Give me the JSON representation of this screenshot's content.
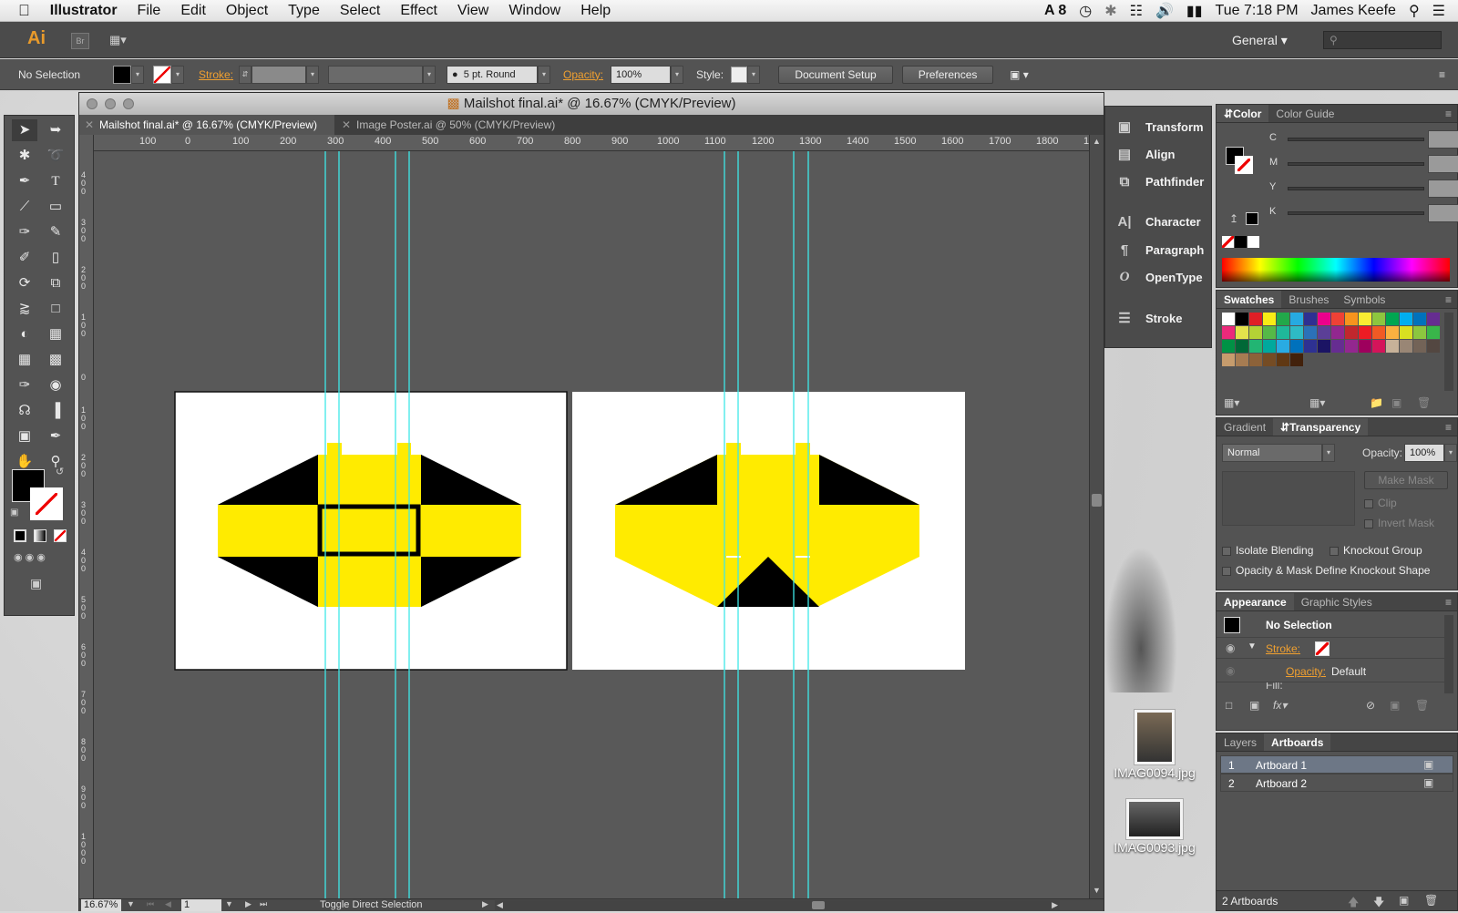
{
  "menubar": {
    "app_name": "Illustrator",
    "items": [
      "File",
      "Edit",
      "Object",
      "Type",
      "Select",
      "Effect",
      "View",
      "Window",
      "Help"
    ],
    "adobe_badge": "8",
    "clock": "Tue 7:18 PM",
    "user": "James Keefe"
  },
  "appbar": {
    "logo": "Ai",
    "bridge": "Br",
    "workspace": "General"
  },
  "control": {
    "selection": "No Selection",
    "stroke_label": "Stroke:",
    "brush": "5 pt. Round",
    "opacity_label": "Opacity:",
    "opacity_value": "100%",
    "style_label": "Style:",
    "doc_setup": "Document Setup",
    "preferences": "Preferences"
  },
  "document": {
    "window_title": "Mailshot final.ai* @ 16.67% (CMYK/Preview)",
    "tabs": [
      {
        "label": "Mailshot final.ai* @ 16.67% (CMYK/Preview)",
        "active": true
      },
      {
        "label": "Image Poster.ai @ 50% (CMYK/Preview)",
        "active": false
      }
    ],
    "ruler_labels": [
      "100",
      "0",
      "100",
      "200",
      "300",
      "400",
      "500",
      "600",
      "700",
      "800",
      "900",
      "1000",
      "1100",
      "1200",
      "1300",
      "1400",
      "1500",
      "1600",
      "1700",
      "1800",
      "1"
    ],
    "vruler_labels": [
      "400",
      "300",
      "200",
      "100",
      "0",
      "100",
      "200",
      "300",
      "400",
      "500",
      "600",
      "700",
      "800",
      "900",
      "1000"
    ],
    "zoom": "16.67%",
    "artboard_nav": "1",
    "status": "Toggle Direct Selection"
  },
  "middock": {
    "items": [
      "Transform",
      "Align",
      "Pathfinder",
      "Character",
      "Paragraph",
      "OpenType",
      "Stroke"
    ]
  },
  "color_panel": {
    "tabs": [
      "Color",
      "Color Guide"
    ],
    "channels": [
      "C",
      "M",
      "Y",
      "K"
    ],
    "percent": "%"
  },
  "swatches_panel": {
    "tabs": [
      "Swatches",
      "Brushes",
      "Symbols"
    ],
    "colors": [
      "#ffffff",
      "#000000",
      "#e01f26",
      "#f8ec15",
      "#22a84a",
      "#26aae1",
      "#2e3092",
      "#ec008c",
      "#ef4136",
      "#f7941d",
      "#f9ed32",
      "#8dc63f",
      "#00a651",
      "#00aeef",
      "#0072bc",
      "#662d91",
      "#ec297b",
      "#e4e24c",
      "#b4d235",
      "#56b947",
      "#1fb89a",
      "#2ebbc5",
      "#2b71b8",
      "#5b3f97",
      "#92278f",
      "#c1272d",
      "#ed1c24",
      "#f15a24",
      "#fbb040",
      "#d9e021",
      "#8cc63f",
      "#39b54a",
      "#009245",
      "#006837",
      "#22b573",
      "#00a99d",
      "#29abe2",
      "#0071bc",
      "#2e3192",
      "#1b1464",
      "#662d91",
      "#93278f",
      "#9e005d",
      "#d4145a",
      "#c7b299",
      "#998675",
      "#736357",
      "#534741",
      "#c69c6d",
      "#a67c52",
      "#8c6239",
      "#754c24",
      "#603813",
      "#42210b"
    ]
  },
  "transparency_panel": {
    "tabs": [
      "Gradient",
      "Transparency"
    ],
    "mode": "Normal",
    "opacity_label": "Opacity:",
    "opacity_value": "100%",
    "make_mask": "Make Mask",
    "clip": "Clip",
    "invert_mask": "Invert Mask",
    "isolate": "Isolate Blending",
    "knockout": "Knockout Group",
    "opacity_mask": "Opacity & Mask Define Knockout Shape"
  },
  "appearance_panel": {
    "tabs": [
      "Appearance",
      "Graphic Styles"
    ],
    "selection": "No Selection",
    "stroke_label": "Stroke:",
    "opacity_label": "Opacity:",
    "opacity_value": "Default",
    "fill_label": "Fill:"
  },
  "artboards_panel": {
    "tabs": [
      "Layers",
      "Artboards"
    ],
    "rows": [
      {
        "num": "1",
        "name": "Artboard 1",
        "selected": true
      },
      {
        "num": "2",
        "name": "Artboard 2",
        "selected": false
      }
    ],
    "footer": "2 Artboards"
  },
  "desktop": {
    "files": [
      "IMAG0094.jpg",
      "IMAG0093.jpg"
    ]
  },
  "colors": {
    "accent_yellow": "#ffeb00",
    "guide_cyan": "#3ee8e8",
    "ai_orange": "#e89a2b"
  }
}
